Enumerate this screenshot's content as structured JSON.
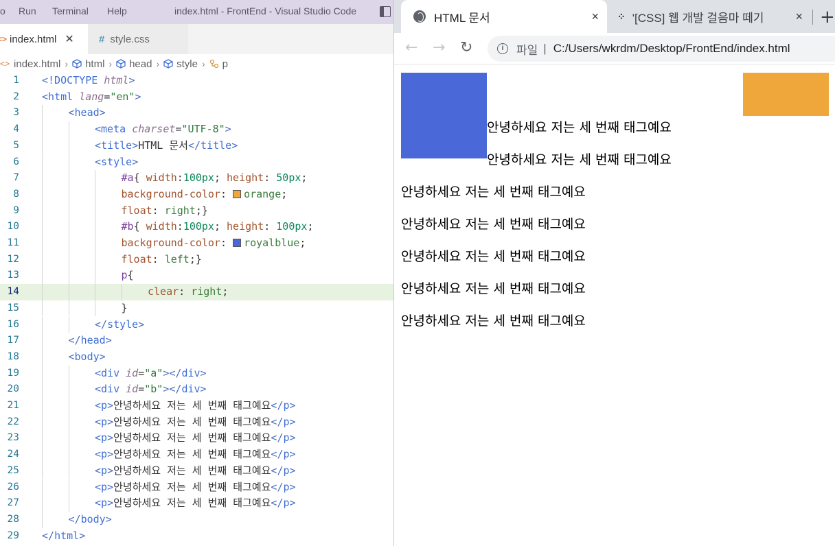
{
  "vscode": {
    "menu": [
      "o",
      "Run",
      "Terminal",
      "Help"
    ],
    "window_title": "index.html - FrontEnd - Visual Studio Code",
    "tabs": [
      {
        "label": "index.html",
        "icon": "html-icon",
        "active": true
      },
      {
        "label": "style.css",
        "icon": "hash-icon",
        "active": false
      }
    ],
    "breadcrumb": [
      "index.html",
      "html",
      "head",
      "style",
      "p"
    ],
    "swatch_colors": {
      "orange": "#efa63a",
      "royalblue": "#4a68d8"
    },
    "lines": [
      {
        "num": "1",
        "text": "<!DOCTYPE html>"
      },
      {
        "num": "2",
        "text": "<html lang=\"en\">"
      },
      {
        "num": "3",
        "text": "<head>"
      },
      {
        "num": "4",
        "text": "<meta charset=\"UTF-8\">"
      },
      {
        "num": "5",
        "text": "<title>HTML 문서</title>"
      },
      {
        "num": "6",
        "text": "<style>"
      },
      {
        "num": "7",
        "text": "#a{ width:100px; height: 50px;"
      },
      {
        "num": "8",
        "text": "background-color: orange;"
      },
      {
        "num": "9",
        "text": "float: right;}"
      },
      {
        "num": "10",
        "text": "#b{ width:100px; height: 100px;"
      },
      {
        "num": "11",
        "text": "background-color: royalblue;"
      },
      {
        "num": "12",
        "text": "float: left;}"
      },
      {
        "num": "13",
        "text": "p{"
      },
      {
        "num": "14",
        "text": "clear: right;"
      },
      {
        "num": "15",
        "text": "}"
      },
      {
        "num": "16",
        "text": "</style>"
      },
      {
        "num": "17",
        "text": "</head>"
      },
      {
        "num": "18",
        "text": "<body>"
      },
      {
        "num": "19",
        "text": "<div id=\"a\"></div>"
      },
      {
        "num": "20",
        "text": "<div id=\"b\"></div>"
      },
      {
        "num": "21",
        "text": "<p>안녕하세요 저는 세 번째 태그예요</p>"
      },
      {
        "num": "22",
        "text": "<p>안녕하세요 저는 세 번째 태그예요</p>"
      },
      {
        "num": "23",
        "text": "<p>안녕하세요 저는 세 번째 태그예요</p>"
      },
      {
        "num": "24",
        "text": "<p>안녕하세요 저는 세 번째 태그예요</p>"
      },
      {
        "num": "25",
        "text": "<p>안녕하세요 저는 세 번째 태그예요</p>"
      },
      {
        "num": "26",
        "text": "<p>안녕하세요 저는 세 번째 태그예요</p>"
      },
      {
        "num": "27",
        "text": "<p>안녕하세요 저는 세 번째 태그예요</p>"
      },
      {
        "num": "28",
        "text": "</body>"
      },
      {
        "num": "29",
        "text": "</html>"
      }
    ],
    "current_line": "14"
  },
  "browser": {
    "tabs": [
      {
        "title": "HTML 문서",
        "icon": "globe-icon",
        "active": true
      },
      {
        "title": "'[CSS] 웹 개발 걸음마 떼기",
        "icon": "dots-icon",
        "active": false
      }
    ],
    "close_glyph": "×",
    "new_tab_glyph": "+",
    "address": {
      "scheme_label": "파일",
      "url": "C:/Users/wkrdm/Desktop/FrontEnd/index.html"
    },
    "page": {
      "box_a_color": "#efa63a",
      "box_b_color": "#4a68d8",
      "paragraphs": [
        "안녕하세요 저는 세 번째 태그예요",
        "안녕하세요 저는 세 번째 태그예요",
        "안녕하세요 저는 세 번째 태그예요",
        "안녕하세요 저는 세 번째 태그예요",
        "안녕하세요 저는 세 번째 태그예요",
        "안녕하세요 저는 세 번째 태그예요",
        "안녕하세요 저는 세 번째 태그예요"
      ]
    }
  }
}
